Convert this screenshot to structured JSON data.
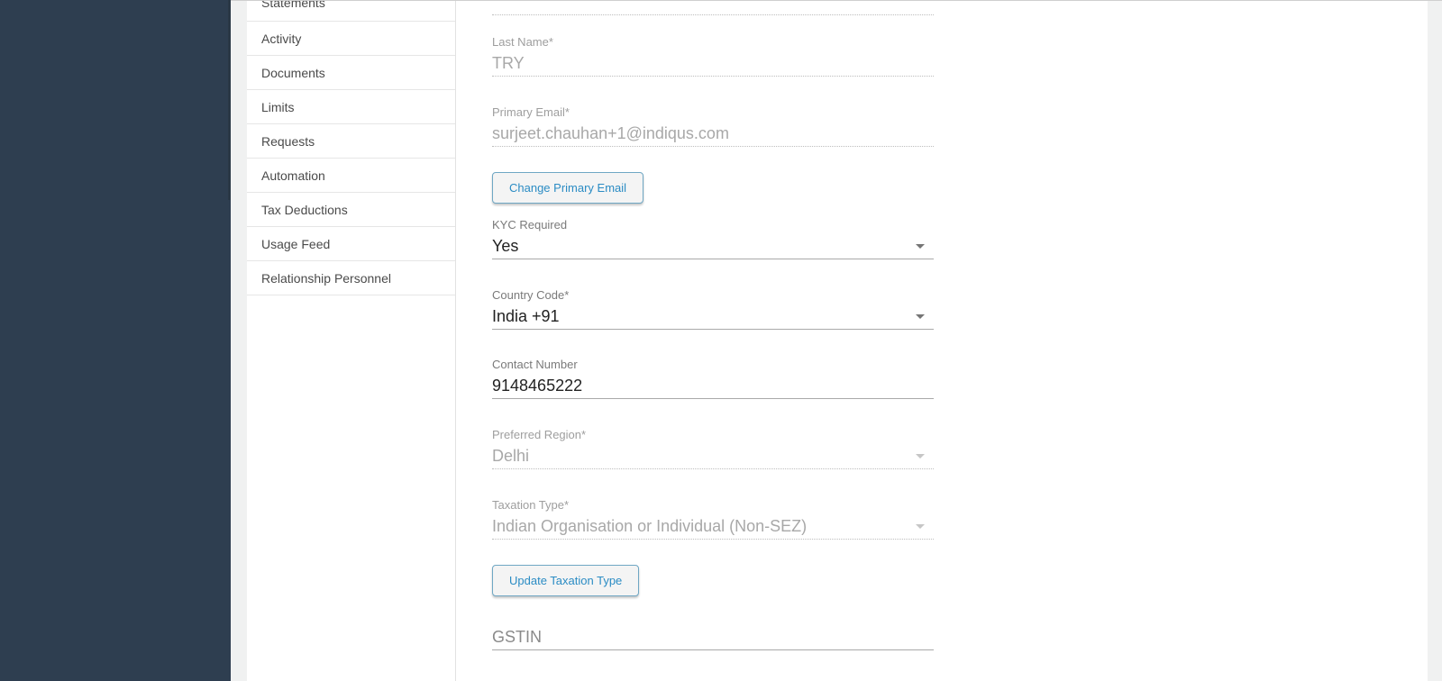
{
  "sub_nav": {
    "items": [
      {
        "label": "Statements"
      },
      {
        "label": "Activity"
      },
      {
        "label": "Documents"
      },
      {
        "label": "Limits"
      },
      {
        "label": "Requests"
      },
      {
        "label": "Automation"
      },
      {
        "label": "Tax Deductions"
      },
      {
        "label": "Usage Feed"
      },
      {
        "label": "Relationship Personnel"
      }
    ]
  },
  "form": {
    "last_name": {
      "label": "Last Name*",
      "value": "TRY"
    },
    "primary_email": {
      "label": "Primary Email*",
      "value": "surjeet.chauhan+1@indiqus.com"
    },
    "change_email_button": "Change Primary Email",
    "kyc_required": {
      "label": "KYC Required",
      "value": "Yes"
    },
    "country_code": {
      "label": "Country Code*",
      "value": "India +91"
    },
    "contact_number": {
      "label": "Contact Number",
      "value": "9148465222"
    },
    "preferred_region": {
      "label": "Preferred Region*",
      "value": "Delhi"
    },
    "taxation_type": {
      "label": "Taxation Type*",
      "value": "Indian Organisation or Individual (Non-SEZ)"
    },
    "update_taxation_button": "Update Taxation Type",
    "gstin": {
      "placeholder": "GSTIN"
    }
  },
  "colors": {
    "left_nav_bg": "#2e3e50",
    "accent": "#2b8cc4"
  }
}
